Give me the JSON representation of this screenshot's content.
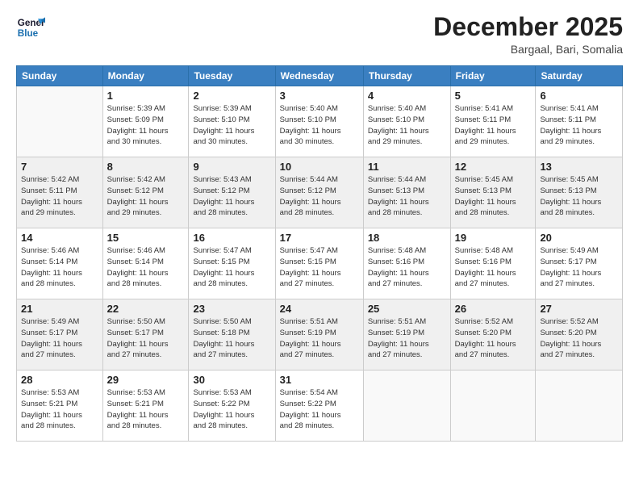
{
  "logo": {
    "line1": "General",
    "line2": "Blue"
  },
  "title": "December 2025",
  "location": "Bargaal, Bari, Somalia",
  "headers": [
    "Sunday",
    "Monday",
    "Tuesday",
    "Wednesday",
    "Thursday",
    "Friday",
    "Saturday"
  ],
  "weeks": [
    [
      {
        "num": "",
        "info": ""
      },
      {
        "num": "1",
        "info": "Sunrise: 5:39 AM\nSunset: 5:09 PM\nDaylight: 11 hours\nand 30 minutes."
      },
      {
        "num": "2",
        "info": "Sunrise: 5:39 AM\nSunset: 5:10 PM\nDaylight: 11 hours\nand 30 minutes."
      },
      {
        "num": "3",
        "info": "Sunrise: 5:40 AM\nSunset: 5:10 PM\nDaylight: 11 hours\nand 30 minutes."
      },
      {
        "num": "4",
        "info": "Sunrise: 5:40 AM\nSunset: 5:10 PM\nDaylight: 11 hours\nand 29 minutes."
      },
      {
        "num": "5",
        "info": "Sunrise: 5:41 AM\nSunset: 5:11 PM\nDaylight: 11 hours\nand 29 minutes."
      },
      {
        "num": "6",
        "info": "Sunrise: 5:41 AM\nSunset: 5:11 PM\nDaylight: 11 hours\nand 29 minutes."
      }
    ],
    [
      {
        "num": "7",
        "info": "Sunrise: 5:42 AM\nSunset: 5:11 PM\nDaylight: 11 hours\nand 29 minutes."
      },
      {
        "num": "8",
        "info": "Sunrise: 5:42 AM\nSunset: 5:12 PM\nDaylight: 11 hours\nand 29 minutes."
      },
      {
        "num": "9",
        "info": "Sunrise: 5:43 AM\nSunset: 5:12 PM\nDaylight: 11 hours\nand 28 minutes."
      },
      {
        "num": "10",
        "info": "Sunrise: 5:44 AM\nSunset: 5:12 PM\nDaylight: 11 hours\nand 28 minutes."
      },
      {
        "num": "11",
        "info": "Sunrise: 5:44 AM\nSunset: 5:13 PM\nDaylight: 11 hours\nand 28 minutes."
      },
      {
        "num": "12",
        "info": "Sunrise: 5:45 AM\nSunset: 5:13 PM\nDaylight: 11 hours\nand 28 minutes."
      },
      {
        "num": "13",
        "info": "Sunrise: 5:45 AM\nSunset: 5:13 PM\nDaylight: 11 hours\nand 28 minutes."
      }
    ],
    [
      {
        "num": "14",
        "info": "Sunrise: 5:46 AM\nSunset: 5:14 PM\nDaylight: 11 hours\nand 28 minutes."
      },
      {
        "num": "15",
        "info": "Sunrise: 5:46 AM\nSunset: 5:14 PM\nDaylight: 11 hours\nand 28 minutes."
      },
      {
        "num": "16",
        "info": "Sunrise: 5:47 AM\nSunset: 5:15 PM\nDaylight: 11 hours\nand 28 minutes."
      },
      {
        "num": "17",
        "info": "Sunrise: 5:47 AM\nSunset: 5:15 PM\nDaylight: 11 hours\nand 27 minutes."
      },
      {
        "num": "18",
        "info": "Sunrise: 5:48 AM\nSunset: 5:16 PM\nDaylight: 11 hours\nand 27 minutes."
      },
      {
        "num": "19",
        "info": "Sunrise: 5:48 AM\nSunset: 5:16 PM\nDaylight: 11 hours\nand 27 minutes."
      },
      {
        "num": "20",
        "info": "Sunrise: 5:49 AM\nSunset: 5:17 PM\nDaylight: 11 hours\nand 27 minutes."
      }
    ],
    [
      {
        "num": "21",
        "info": "Sunrise: 5:49 AM\nSunset: 5:17 PM\nDaylight: 11 hours\nand 27 minutes."
      },
      {
        "num": "22",
        "info": "Sunrise: 5:50 AM\nSunset: 5:17 PM\nDaylight: 11 hours\nand 27 minutes."
      },
      {
        "num": "23",
        "info": "Sunrise: 5:50 AM\nSunset: 5:18 PM\nDaylight: 11 hours\nand 27 minutes."
      },
      {
        "num": "24",
        "info": "Sunrise: 5:51 AM\nSunset: 5:19 PM\nDaylight: 11 hours\nand 27 minutes."
      },
      {
        "num": "25",
        "info": "Sunrise: 5:51 AM\nSunset: 5:19 PM\nDaylight: 11 hours\nand 27 minutes."
      },
      {
        "num": "26",
        "info": "Sunrise: 5:52 AM\nSunset: 5:20 PM\nDaylight: 11 hours\nand 27 minutes."
      },
      {
        "num": "27",
        "info": "Sunrise: 5:52 AM\nSunset: 5:20 PM\nDaylight: 11 hours\nand 27 minutes."
      }
    ],
    [
      {
        "num": "28",
        "info": "Sunrise: 5:53 AM\nSunset: 5:21 PM\nDaylight: 11 hours\nand 28 minutes."
      },
      {
        "num": "29",
        "info": "Sunrise: 5:53 AM\nSunset: 5:21 PM\nDaylight: 11 hours\nand 28 minutes."
      },
      {
        "num": "30",
        "info": "Sunrise: 5:53 AM\nSunset: 5:22 PM\nDaylight: 11 hours\nand 28 minutes."
      },
      {
        "num": "31",
        "info": "Sunrise: 5:54 AM\nSunset: 5:22 PM\nDaylight: 11 hours\nand 28 minutes."
      },
      {
        "num": "",
        "info": ""
      },
      {
        "num": "",
        "info": ""
      },
      {
        "num": "",
        "info": ""
      }
    ]
  ]
}
